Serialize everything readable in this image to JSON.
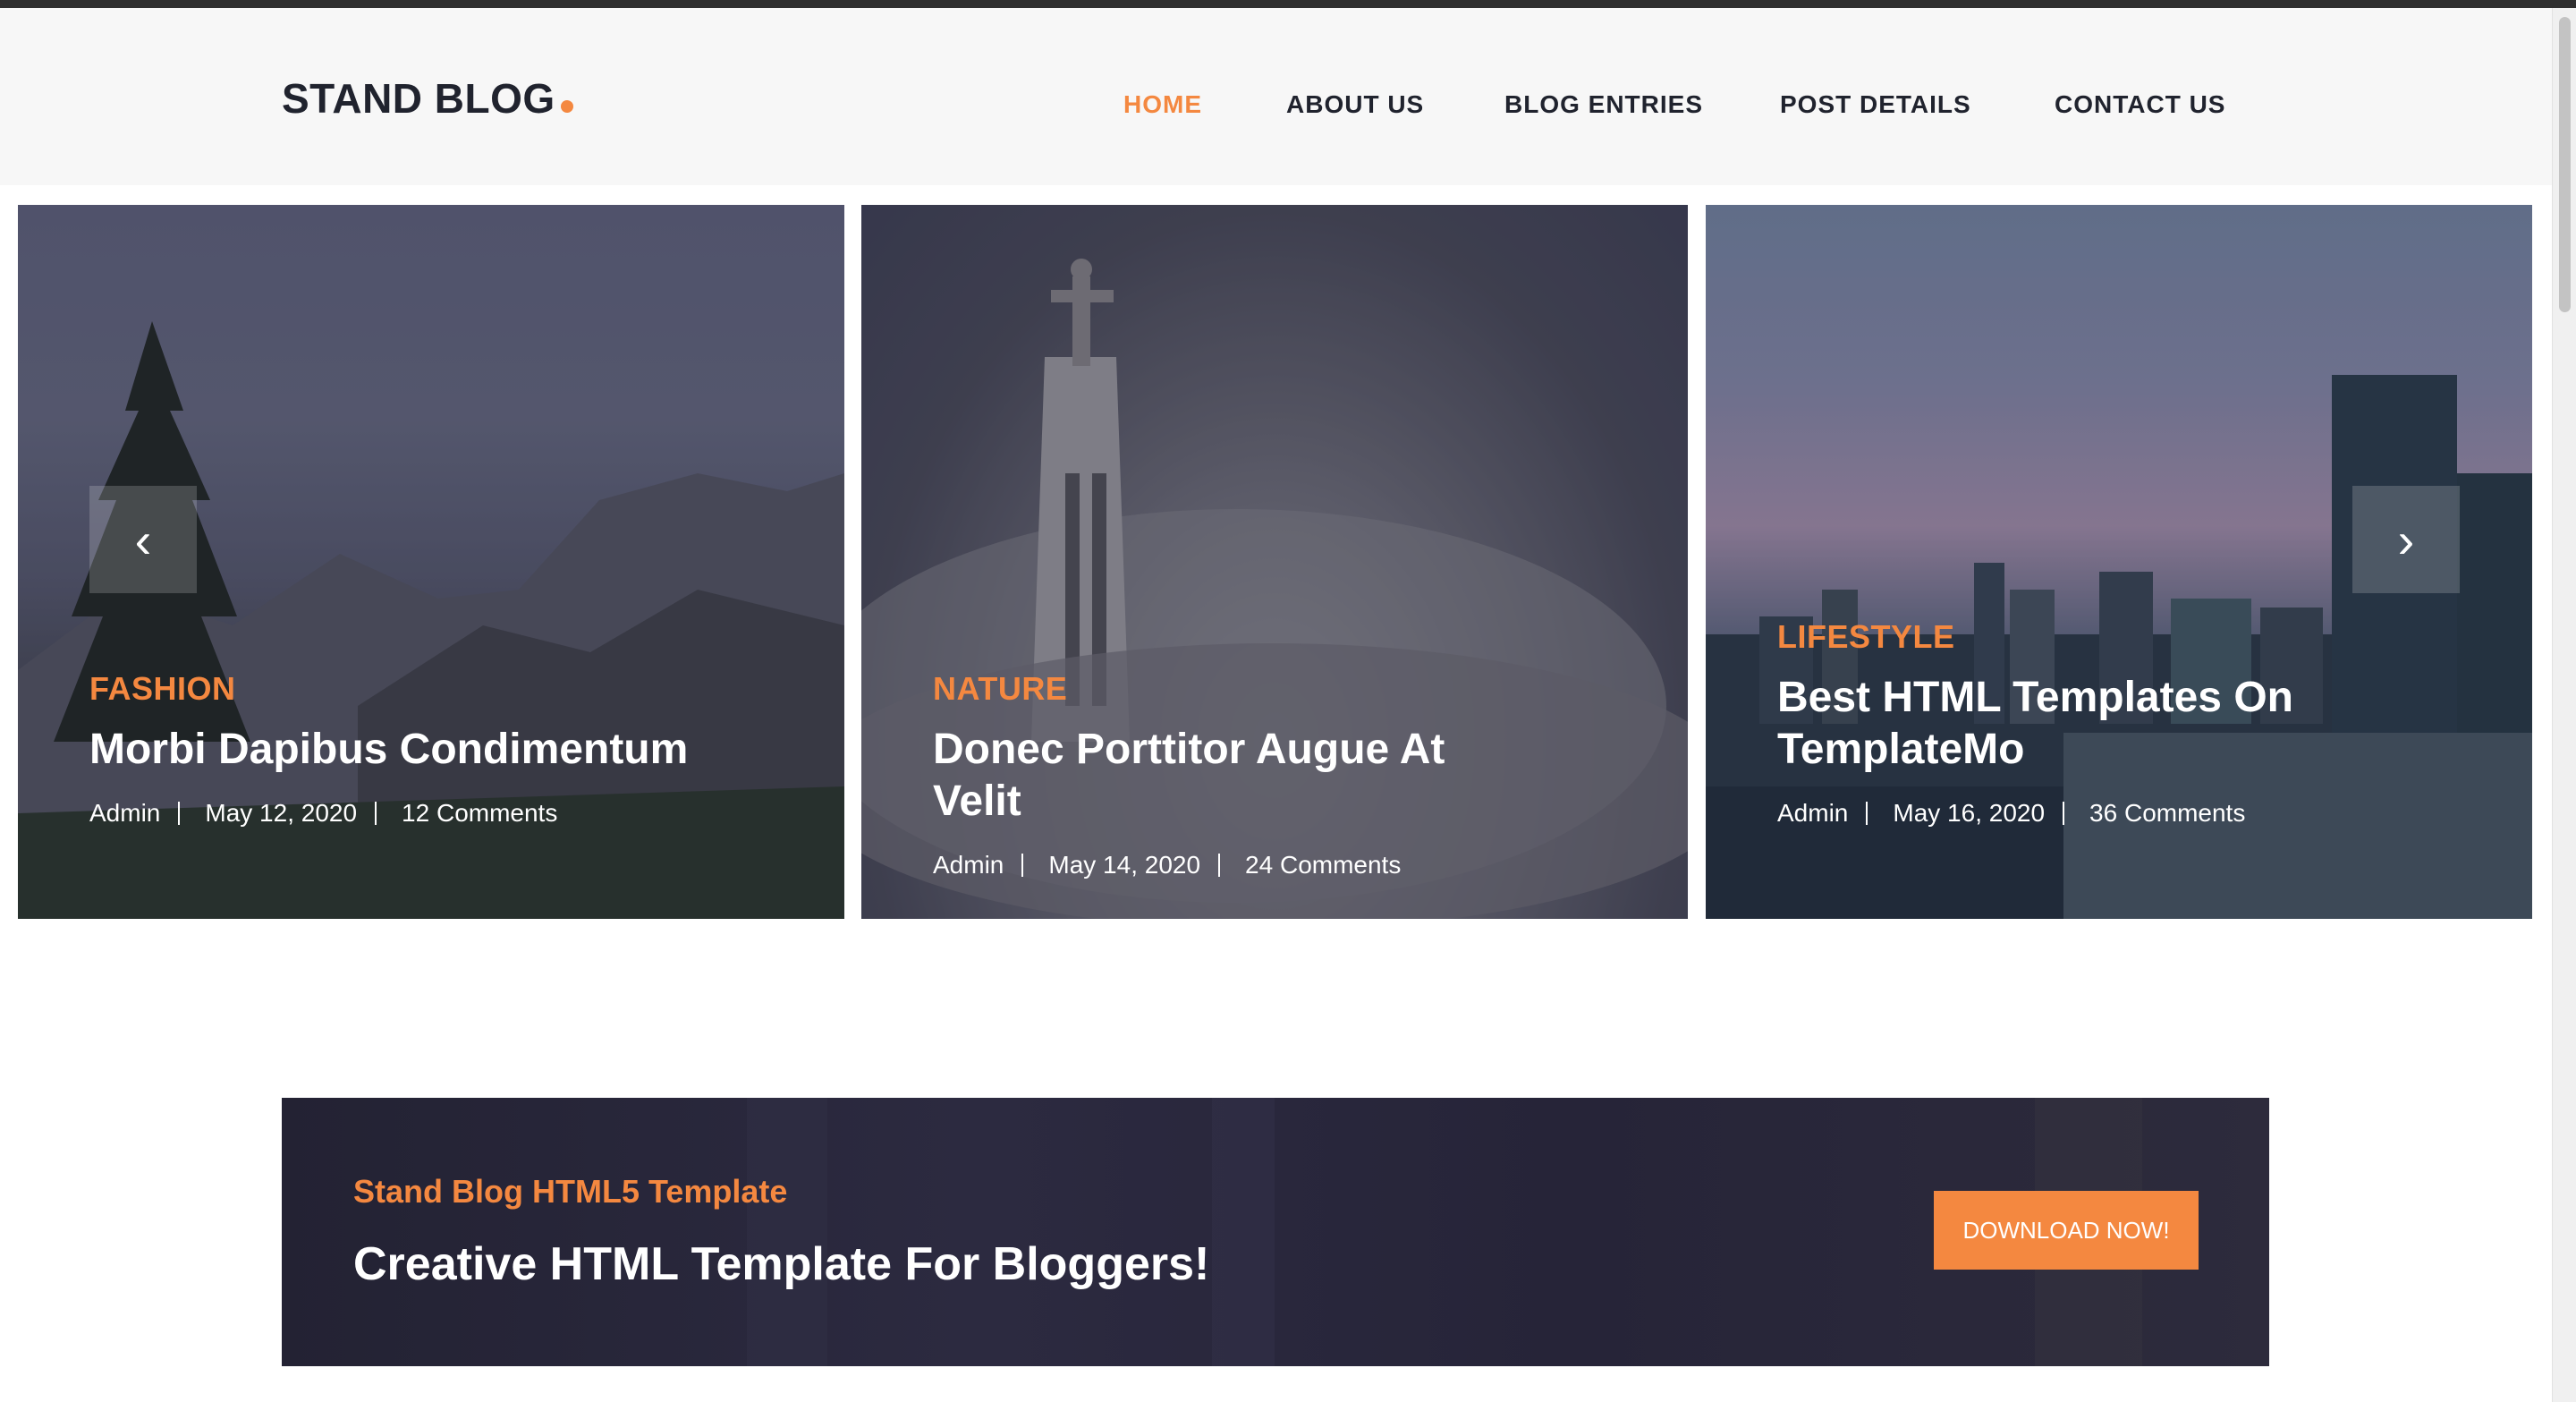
{
  "header": {
    "logo_text": "STAND BLOG",
    "nav": [
      {
        "label": "HOME",
        "active": true
      },
      {
        "label": "ABOUT US",
        "active": false
      },
      {
        "label": "BLOG ENTRIES",
        "active": false
      },
      {
        "label": "POST DETAILS",
        "active": false
      },
      {
        "label": "CONTACT US",
        "active": false
      }
    ]
  },
  "carousel": {
    "prev_icon": "‹",
    "next_icon": "›",
    "slides": [
      {
        "category": "FASHION",
        "title": "Morbi Dapibus Condimentum",
        "author": "Admin",
        "date": "May 12, 2020",
        "comments": "12 Comments"
      },
      {
        "category": "NATURE",
        "title": "Donec Porttitor Augue At Velit",
        "author": "Admin",
        "date": "May 14, 2020",
        "comments": "24 Comments"
      },
      {
        "category": "LIFESTYLE",
        "title": "Best HTML Templates On TemplateMo",
        "author": "Admin",
        "date": "May 16, 2020",
        "comments": "36 Comments"
      }
    ]
  },
  "cta": {
    "subtitle": "Stand Blog HTML5 Template",
    "title": "Creative HTML Template For Bloggers!",
    "button_label": "DOWNLOAD NOW!"
  },
  "colors": {
    "accent": "#f48840",
    "text_dark": "#20232e",
    "header_bg": "#f7f7f7",
    "cta_bg": "#262438"
  }
}
